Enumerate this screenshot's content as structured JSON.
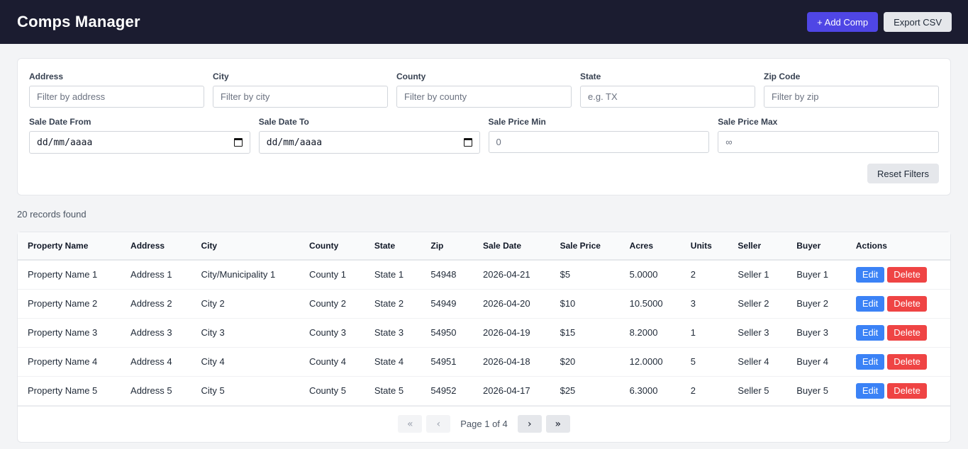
{
  "header": {
    "title": "Comps Manager",
    "add_label": "+ Add Comp",
    "export_label": "Export CSV"
  },
  "filters": {
    "address": {
      "label": "Address",
      "placeholder": "Filter by address"
    },
    "city": {
      "label": "City",
      "placeholder": "Filter by city"
    },
    "county": {
      "label": "County",
      "placeholder": "Filter by county"
    },
    "state": {
      "label": "State",
      "placeholder": "e.g. TX"
    },
    "zip": {
      "label": "Zip Code",
      "placeholder": "Filter by zip"
    },
    "date_from": {
      "label": "Sale Date From",
      "value": "dd/mm/aaaa"
    },
    "date_to": {
      "label": "Sale Date To",
      "value": "dd/mm/aaaa"
    },
    "price_min": {
      "label": "Sale Price Min",
      "placeholder": "0"
    },
    "price_max": {
      "label": "Sale Price Max",
      "placeholder": "∞"
    },
    "reset_label": "Reset Filters"
  },
  "records_text": "20 records found",
  "table": {
    "columns": [
      "Property Name",
      "Address",
      "City",
      "County",
      "State",
      "Zip",
      "Sale Date",
      "Sale Price",
      "Acres",
      "Units",
      "Seller",
      "Buyer",
      "Actions"
    ],
    "rows": [
      [
        "Property Name 1",
        "Address 1",
        "City/Municipality 1",
        "County 1",
        "State 1",
        "54948",
        "2026-04-21",
        "$5",
        "5.0000",
        "2",
        "Seller 1",
        "Buyer 1"
      ],
      [
        "Property Name 2",
        "Address 2",
        "City 2",
        "County 2",
        "State 2",
        "54949",
        "2026-04-20",
        "$10",
        "10.5000",
        "3",
        "Seller 2",
        "Buyer 2"
      ],
      [
        "Property Name 3",
        "Address 3",
        "City 3",
        "County 3",
        "State 3",
        "54950",
        "2026-04-19",
        "$15",
        "8.2000",
        "1",
        "Seller 3",
        "Buyer 3"
      ],
      [
        "Property Name 4",
        "Address 4",
        "City 4",
        "County 4",
        "State 4",
        "54951",
        "2026-04-18",
        "$20",
        "12.0000",
        "5",
        "Seller 4",
        "Buyer 4"
      ],
      [
        "Property Name 5",
        "Address 5",
        "City 5",
        "County 5",
        "State 5",
        "54952",
        "2026-04-17",
        "$25",
        "6.3000",
        "2",
        "Seller 5",
        "Buyer 5"
      ]
    ],
    "edit_label": "Edit",
    "delete_label": "Delete"
  },
  "pagination": {
    "first": "«",
    "prev": "‹",
    "label": "Page 1 of 4",
    "next": "›",
    "last": "»"
  }
}
